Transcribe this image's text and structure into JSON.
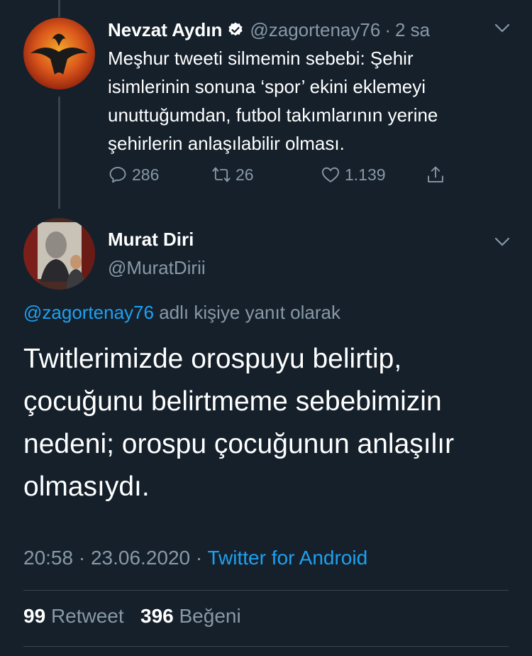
{
  "quoted_tweet": {
    "display_name": "Nevzat Aydın",
    "handle": "@zagortenay76",
    "separator": "·",
    "time_ago": "2 sa",
    "text_lines": [
      "Meşhur tweeti silmemin sebebi: Şehir",
      "isimlerinin sonuna ‘spor’ ekini eklemeyi",
      "unuttuğumdan, futbol takımlarının yerine",
      "şehirlerin anlaşılabilir olması."
    ],
    "replies": "286",
    "retweets": "26",
    "likes": "1.139",
    "icons": [
      "reply-icon",
      "retweet-icon",
      "like-icon",
      "share-icon",
      "verified-badge-icon",
      "chevron-down-icon"
    ]
  },
  "main_tweet": {
    "display_name": "Murat Diri",
    "handle": "@MuratDirii",
    "reply_to_handle": "@zagortenay76",
    "reply_to_suffix": "adlı kişiye yanıt olarak",
    "text_lines": [
      "Twitlerimizde orospuyu belirtip,",
      "çocuğunu belirtmeme sebebimizin",
      "nedeni; orospu çocuğunun anlaşılır",
      "olmasıydı."
    ],
    "time": "20:58",
    "date": "23.06.2020",
    "dot": "·",
    "source": "Twitter for Android",
    "retweet_count": "99",
    "retweet_label": "Retweet",
    "like_count": "396",
    "like_label": "Beğeni"
  },
  "colors": {
    "background": "#15202b",
    "accent": "#1da1f2",
    "secondary_text": "#8899a6",
    "divider": "#38444d"
  }
}
